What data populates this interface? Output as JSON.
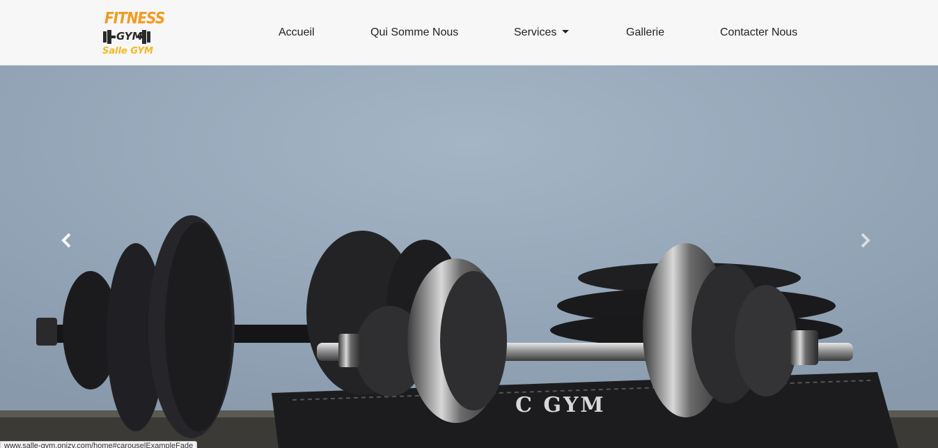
{
  "logo": {
    "line1": "FITNESS",
    "line2": "GYM",
    "line3": "Salle GYM"
  },
  "nav": {
    "items": [
      {
        "label": "Accueil"
      },
      {
        "label": "Qui Somme Nous"
      },
      {
        "label": "Services",
        "has_dropdown": true
      },
      {
        "label": "Gallerie"
      },
      {
        "label": "Contacter Nous"
      }
    ]
  },
  "carousel": {
    "prev_icon": "chevron-left-icon",
    "next_icon": "chevron-right-icon",
    "slide_text": "C GYM"
  },
  "status_bar": {
    "url": "www.salle-gym.onizy.com/home#carouselExampleFade"
  },
  "colors": {
    "brand_orange": "#f29a1f",
    "brand_yellow": "#f6b81f",
    "nav_bg": "#f7f7f7",
    "nav_text": "#222222"
  }
}
